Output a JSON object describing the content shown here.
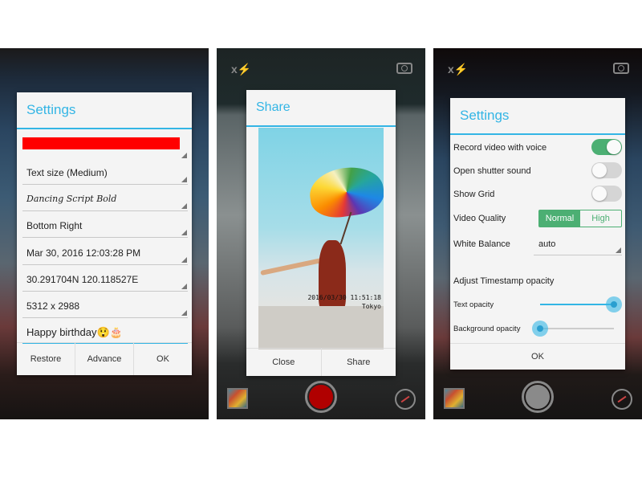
{
  "panel1": {
    "dialog_title": "Settings",
    "color_swatch": "#ff0000",
    "spinners": [
      {
        "label": "Text size (Medium)"
      },
      {
        "label": "Dancing Script Bold"
      },
      {
        "label": "Bottom Right"
      },
      {
        "label": "Mar 30, 2016 12:03:28 PM"
      },
      {
        "label": "30.291704N 120.118527E"
      },
      {
        "label": "5312 x 2988"
      }
    ],
    "custom_text": "Happy  birthday😲🎂",
    "buttons": {
      "restore": "Restore",
      "advance": "Advance",
      "ok": "OK"
    }
  },
  "panel2": {
    "dialog_title": "Share",
    "photo_timestamp": "2016/03/30 11:51:18",
    "photo_location": "Tokyo",
    "buttons": {
      "close": "Close",
      "share": "Share"
    },
    "flash_icon_text": "x⚡",
    "shutter_color": "#b00000"
  },
  "panel3": {
    "dialog_title": "Settings",
    "toggles": [
      {
        "label": "Record video with voice",
        "on": true
      },
      {
        "label": "Open shutter sound",
        "on": false
      },
      {
        "label": "Show Grid",
        "on": false
      }
    ],
    "video_quality": {
      "label": "Video Quality",
      "options": [
        "Normal",
        "High"
      ],
      "selected": "Normal"
    },
    "white_balance": {
      "label": "White Balance",
      "value": "auto"
    },
    "opacity_section": "Adjust Timestamp opacity",
    "text_opacity": {
      "label": "Text opacity",
      "value_percent": 100
    },
    "background_opacity": {
      "label": "Background opacity",
      "value_percent": 0
    },
    "ok": "OK",
    "flash_icon_text": "x⚡",
    "shutter_color": "#8a8a8a"
  },
  "colors": {
    "accent": "#33b5e5",
    "toggle_on": "#4caf73"
  }
}
